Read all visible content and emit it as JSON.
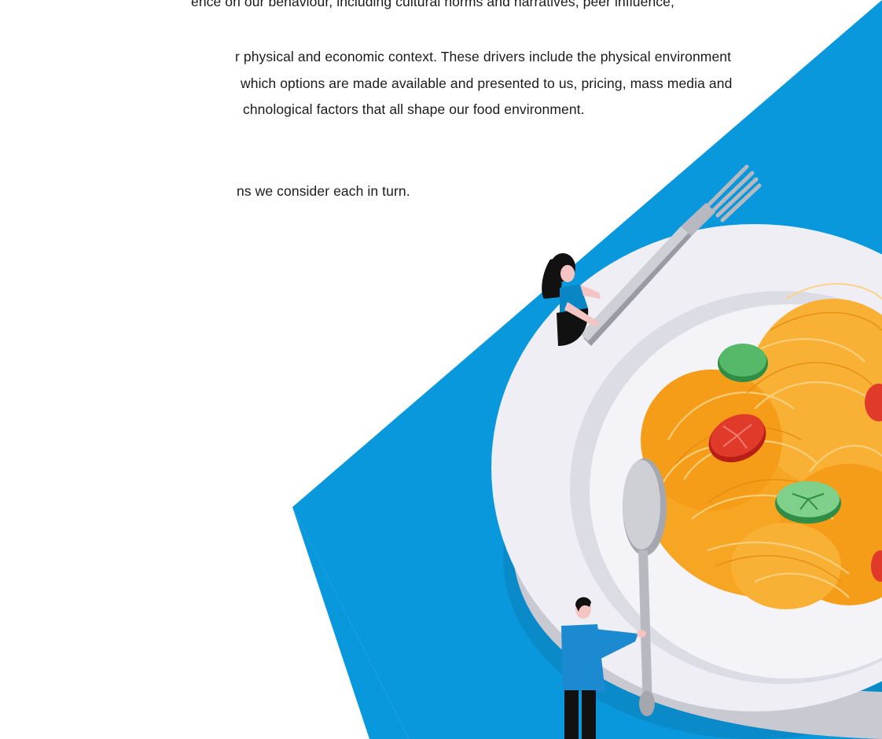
{
  "text": {
    "line_1": "ence on our behaviour, including cultural norms and narratives, peer influence,",
    "line_2": "r physical and economic context. These drivers include the physical environment",
    "line_3": "which options are made available and presented to us, pricing, mass media and",
    "line_4": "chnological factors that all shape our food environment.",
    "line_5": "ns we consider each in turn."
  },
  "illustration": {
    "subject": "giant-spaghetti-plate-with-tiny-people",
    "icons": [
      "fork-icon",
      "spoon-icon",
      "plate-icon",
      "spaghetti-icon",
      "tomato-slice-icon",
      "cucumber-slice-icon",
      "woman-figure-icon",
      "man-figure-icon"
    ]
  },
  "colors": {
    "background_triangle": "#0a98dc",
    "plate": "#eeeef4",
    "plate_rim_shadow": "#c9c9d2",
    "spaghetti": "#f7a623",
    "tomato": "#e03b2a",
    "cucumber": "#43b35c",
    "cutlery": "#b8b8c0",
    "text": "#1b1b1b"
  }
}
